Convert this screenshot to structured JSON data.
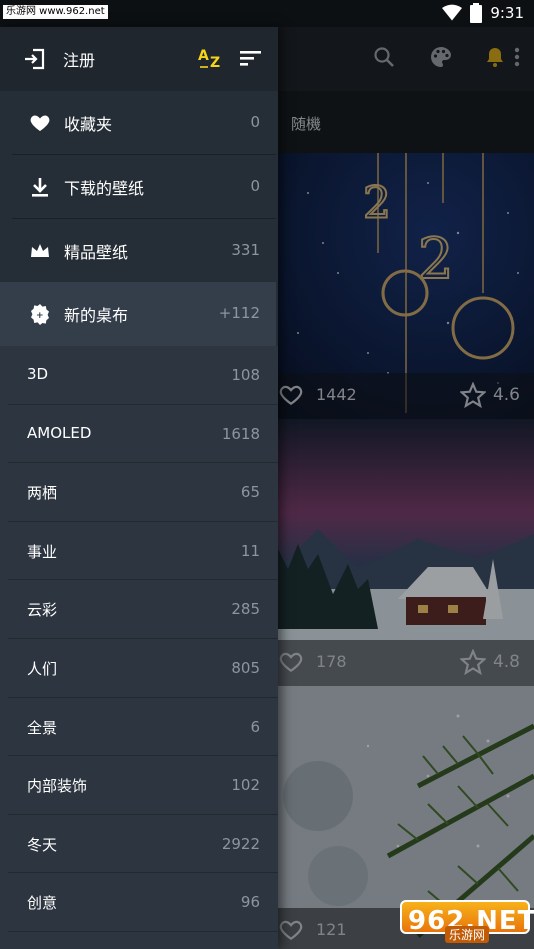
{
  "status_bar": {
    "watermark": "乐游网 www.962.net",
    "time": "9:31"
  },
  "drawer": {
    "login_label": "注册",
    "quick_items": [
      {
        "label": "收藏夹",
        "count": "0",
        "icon": "heart-icon"
      },
      {
        "label": "下载的壁纸",
        "count": "0",
        "icon": "download-icon"
      },
      {
        "label": "精品壁纸",
        "count": "331",
        "icon": "crown-icon"
      },
      {
        "label": "新的桌布",
        "count": "+112",
        "icon": "new-badge-icon"
      }
    ],
    "categories": [
      {
        "label": "3D",
        "count": "108"
      },
      {
        "label": "AMOLED",
        "count": "1618"
      },
      {
        "label": "两栖",
        "count": "65"
      },
      {
        "label": "事业",
        "count": "11"
      },
      {
        "label": "云彩",
        "count": "285"
      },
      {
        "label": "人们",
        "count": "805"
      },
      {
        "label": "全景",
        "count": "6"
      },
      {
        "label": "内部装饰",
        "count": "102"
      },
      {
        "label": "冬天",
        "count": "2922"
      },
      {
        "label": "创意",
        "count": "96"
      }
    ]
  },
  "background": {
    "tab_label": "随機",
    "cards": [
      {
        "likes": "1442",
        "rating": "4.6"
      },
      {
        "likes": "178",
        "rating": "4.8"
      },
      {
        "likes": "121",
        "rating": ""
      }
    ]
  },
  "logo": {
    "number": "962.NET",
    "sub": "乐游网"
  },
  "colors": {
    "accent_yellow": "#f5d51a",
    "drawer_bg": "#2c3540",
    "header_bg": "#1f262e"
  }
}
